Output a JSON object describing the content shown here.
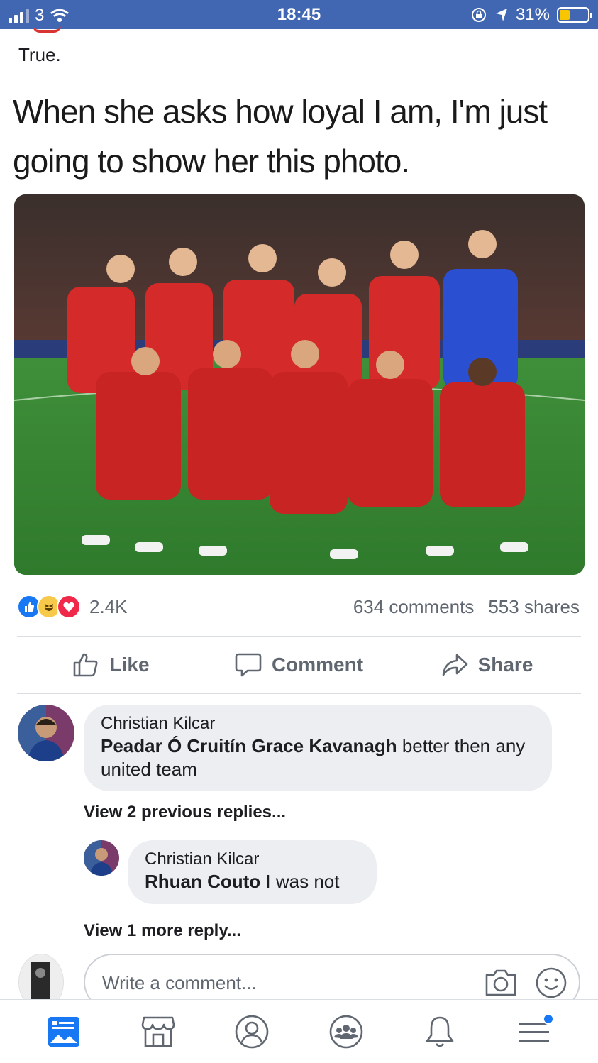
{
  "status_bar": {
    "carrier": "3",
    "time": "18:45",
    "battery": "31%",
    "battery_level": 0.31
  },
  "post": {
    "text": "True.",
    "meme_caption": "When she asks how loyal I am, I'm just going to show her this photo.",
    "image_alt": "Team photo of football squad in red kits"
  },
  "engagement": {
    "reactions": [
      "like-icon",
      "haha-icon",
      "love-icon"
    ],
    "reaction_count": "2.4K",
    "comments": "634 comments",
    "shares": "553 shares"
  },
  "actions": {
    "like": "Like",
    "comment": "Comment",
    "share": "Share"
  },
  "comments": [
    {
      "author": "Christian Kilcar",
      "mentions": "Peadar Ó Cruitín Grace Kavanagh",
      "text": " better then any united team"
    }
  ],
  "view_previous": "View 2 previous replies...",
  "reply": {
    "author": "Christian Kilcar",
    "mention": "Rhuan Couto",
    "text": " I was not"
  },
  "view_more": "View 1 more reply...",
  "composer": {
    "placeholder": "Write a comment..."
  },
  "tabs": [
    "news-feed-icon",
    "marketplace-icon",
    "profile-icon",
    "groups-icon",
    "notifications-icon",
    "menu-icon"
  ],
  "colors": {
    "brand": "#4267b2",
    "accent": "#1877f2"
  }
}
